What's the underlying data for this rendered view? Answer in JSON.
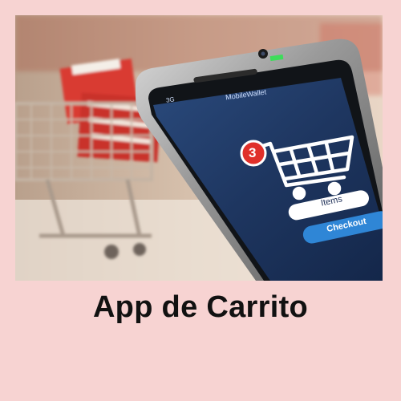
{
  "photo": {
    "phone": {
      "status_signal": "3G",
      "app_title": "MobileWallet",
      "cart_badge_count": "3",
      "items_button_label": "Items",
      "checkout_button_label": "Checkout"
    }
  },
  "caption": {
    "title": "App de Carrito"
  },
  "colors": {
    "background": "#f7d3d2",
    "badge": "#e0302a",
    "checkout": "#2f86d6",
    "screen": "#1e3660"
  }
}
